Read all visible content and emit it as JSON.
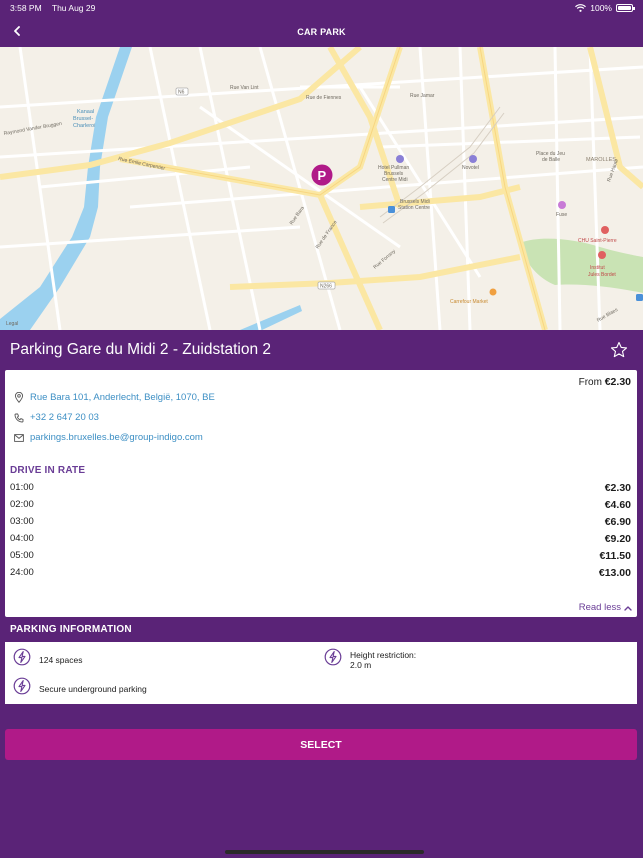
{
  "status_bar": {
    "time": "3:58 PM",
    "date": "Thu Aug 29",
    "battery": "100%"
  },
  "nav": {
    "title": "CAR PARK"
  },
  "map": {
    "labels": {
      "rue_van_lint": "Rue Van Lint",
      "rue_de_fiennes": "Rue de Fiennes",
      "rue_jamar": "Rue Jamar",
      "rue_bara": "Rue Bara",
      "rue_de_france": "Rue de France",
      "rue_emile_carpentier": "Rue Emile Carpentier",
      "raymond": "Raymond Vander Bruggen",
      "kanaal": "Kanaal",
      "kanaal2": "Brussel-",
      "kanaal3": "Charleroi",
      "n6": "N6",
      "n266": "N266",
      "hotel1": "Hotel Pullman",
      "hotel2": "Brussels",
      "hotel3": "Centre Midi",
      "novotel": "Novotel",
      "station1": "Brussels Midi",
      "station2": "Station Centre",
      "place": "Place du Jeu",
      "place2": "de Balle",
      "marolles": "MAROLLES",
      "fuse": "Fuse",
      "chu": "CHU Saint-Pierre",
      "institut1": "Institut",
      "institut2": "Jules Bordet",
      "carrefour": "Carrefour Market",
      "legal": "Legal",
      "rue_fonsny": "Rue Fonsny",
      "rue_haute": "Rue Haute",
      "rue_blaes": "Rue Blaes"
    }
  },
  "parking": {
    "title": "Parking Gare du Midi 2 - Zuidstation 2",
    "from_label": "From",
    "from_price": "€2.30",
    "address": "Rue Bara 101, Anderlecht, België, 1070, BE",
    "phone": "+32 2 647 20 03",
    "email": "parkings.bruxelles.be@group-indigo.com",
    "rate_heading": "DRIVE IN RATE",
    "rates": [
      {
        "duration": "01:00",
        "price": "€2.30"
      },
      {
        "duration": "02:00",
        "price": "€4.60"
      },
      {
        "duration": "03:00",
        "price": "€6.90"
      },
      {
        "duration": "04:00",
        "price": "€9.20"
      },
      {
        "duration": "05:00",
        "price": "€11.50"
      },
      {
        "duration": "24:00",
        "price": "€13.00"
      }
    ],
    "read_less": "Read less"
  },
  "info": {
    "heading": "PARKING INFORMATION",
    "spaces": "124 spaces",
    "height_label": "Height restriction:",
    "height_value": "2.0 m",
    "secure": "Secure underground parking"
  },
  "select_label": "SELECT",
  "colors": {
    "brand_purple": "#5a2377",
    "accent_magenta": "#b01a88",
    "link_blue": "#3d8fc4"
  }
}
